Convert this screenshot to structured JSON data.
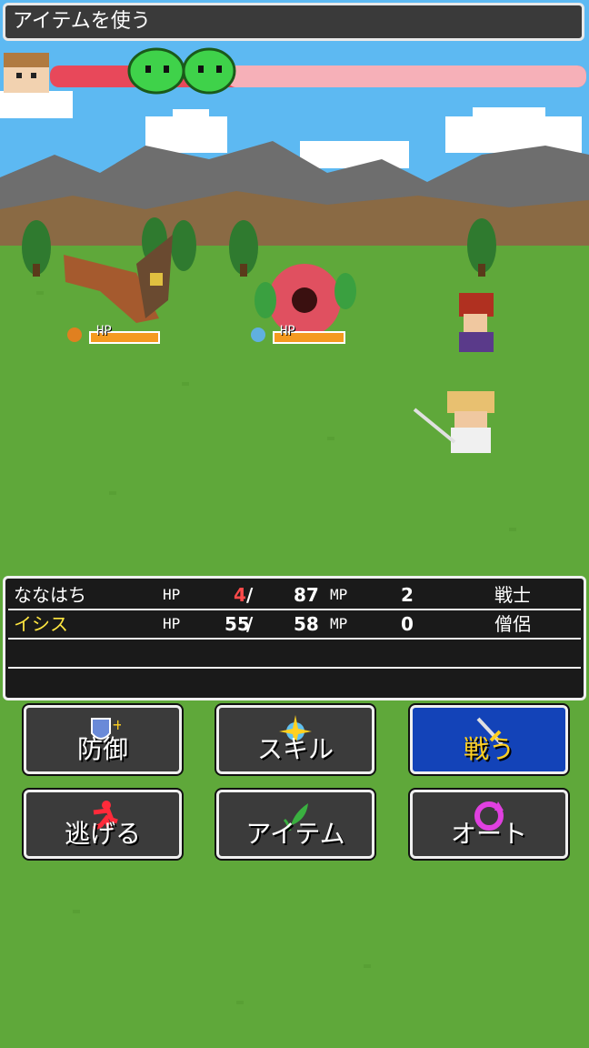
{
  "message": "アイテムを使う",
  "enemies": [
    {
      "name_icon": "hawk-enemy",
      "hp_label": "HP",
      "hp_fraction": 1.0
    },
    {
      "name_icon": "flower-enemy",
      "hp_label": "HP",
      "hp_fraction": 1.0
    }
  ],
  "party": [
    {
      "name": "ななはち",
      "hp_label": "HP",
      "hp": "4",
      "hp_max": "87",
      "mp_label": "MP",
      "mp": "2",
      "job": "戦士",
      "name_color": "#ffffff",
      "hp_color": "#ff4a4a"
    },
    {
      "name": "イシス",
      "hp_label": "HP",
      "hp": "55",
      "hp_max": "58",
      "mp_label": "MP",
      "mp": "0",
      "job": "僧侶",
      "name_color": "#ffe640",
      "hp_color": "#ffffff"
    }
  ],
  "commands": {
    "defend": "防御",
    "skill": "スキル",
    "fight": "戦う",
    "escape": "逃げる",
    "item": "アイテム",
    "auto": "オート"
  },
  "colors": {
    "accent_active": "#1343b8",
    "grass": "#5fa83a",
    "sky": "#5db9f2"
  }
}
